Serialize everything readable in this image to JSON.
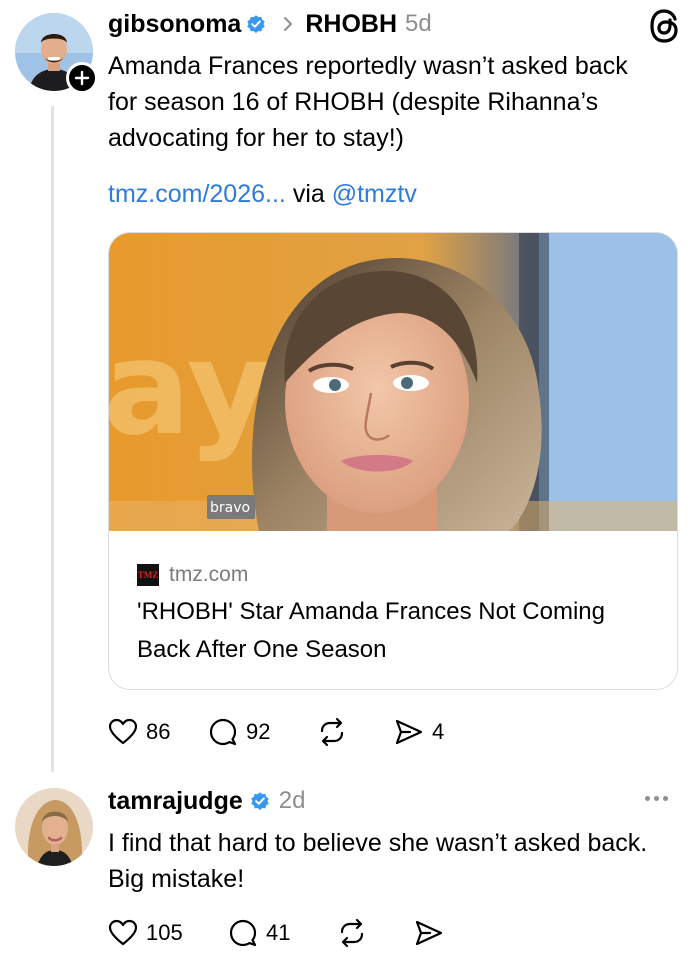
{
  "post": {
    "username": "gibsonoma",
    "community": "RHOBH",
    "age": "5d",
    "text": "Amanda Frances reportedly wasn’t asked back for season 16 of RHOBH (despite Rihanna’s advocating for her to stay!)",
    "link_text": "tmz.com/2026...",
    "via_text": "via",
    "via_handle": "@tmztv",
    "card": {
      "image_badge": "bravo",
      "logo_text": "TMZ",
      "domain": "tmz.com",
      "title": "'RHOBH' Star Amanda Frances Not Coming Back After One Season"
    },
    "likes": "86",
    "replies": "92",
    "shares": "4"
  },
  "reply": {
    "username": "tamrajudge",
    "age": "2d",
    "text": "I find that hard to believe she wasn’t asked back. Big mistake!",
    "likes": "105",
    "replies": "41"
  },
  "icons": {
    "verified": "verified-badge-icon",
    "like": "heart-icon",
    "reply": "comment-icon",
    "repost": "repost-icon",
    "share": "send-icon",
    "threads": "threads-logo-icon",
    "more": "more-dots-icon"
  },
  "colors": {
    "link": "#2f7bd9",
    "verified": "#3897f0",
    "muted": "#8e8e93"
  }
}
